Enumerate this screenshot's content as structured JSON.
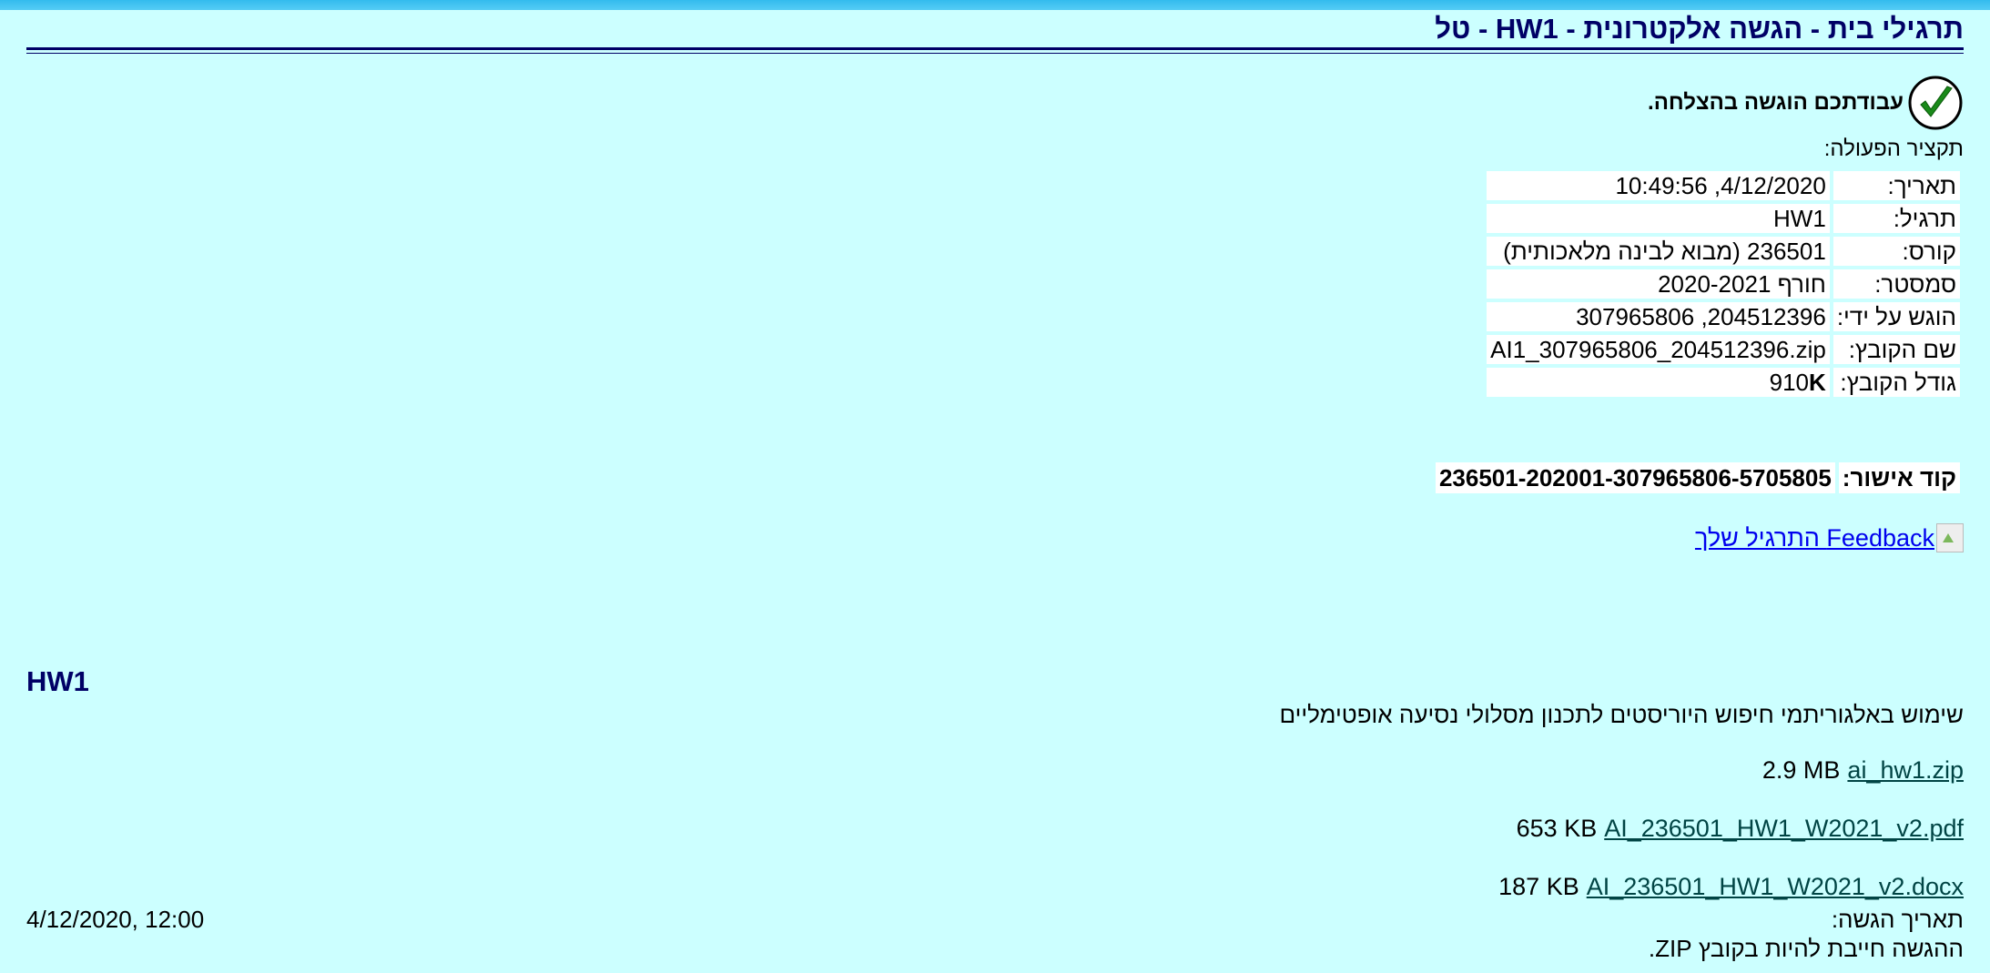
{
  "header": {
    "title": "תרגילי בית - הגשה אלקטרונית - HW1 - טל"
  },
  "status": {
    "message": "עבודתכם הוגשה בהצלחה.",
    "summary_label": "תקציר הפעולה:"
  },
  "details": [
    {
      "label": "תאריך:",
      "value": "4/12/2020, 10:49:56"
    },
    {
      "label": "תרגיל:",
      "value": "HW1"
    },
    {
      "label": "קורס:",
      "value": "236501 (מבוא לבינה מלאכותית)"
    },
    {
      "label": "סמסטר:",
      "value": "חורף 2020-2021"
    },
    {
      "label": "הוגש על ידי:",
      "value": "204512396, 307965806"
    },
    {
      "label": "שם הקובץ:",
      "value": "AI1_307965806_204512396.zip"
    },
    {
      "label": "גודל הקובץ:",
      "value_number": "910",
      "value_unit": "K"
    }
  ],
  "approval": {
    "label": "קוד אישור:",
    "code": "236501-202001-307965806-5705805"
  },
  "feedback": {
    "link_text": "Feedback התרגיל שלך"
  },
  "assignment": {
    "heading": "HW1",
    "description": "שימוש באלגוריתמי חיפוש היוריסטים לתכנון מסלולי נסיעה אופטימליים",
    "files": [
      {
        "name": "ai_hw1.zip",
        "size": "2.9 MB"
      },
      {
        "name": "AI_236501_HW1_W2021_v2.pdf",
        "size": "653 KB"
      },
      {
        "name": "AI_236501_HW1_W2021_v2.docx",
        "size": "187 KB"
      }
    ],
    "due_label": "תאריך הגשה:",
    "due_value": "4/12/2020, 12:00",
    "note": "ההגשה חייבת להיות בקובץ ZIP."
  }
}
